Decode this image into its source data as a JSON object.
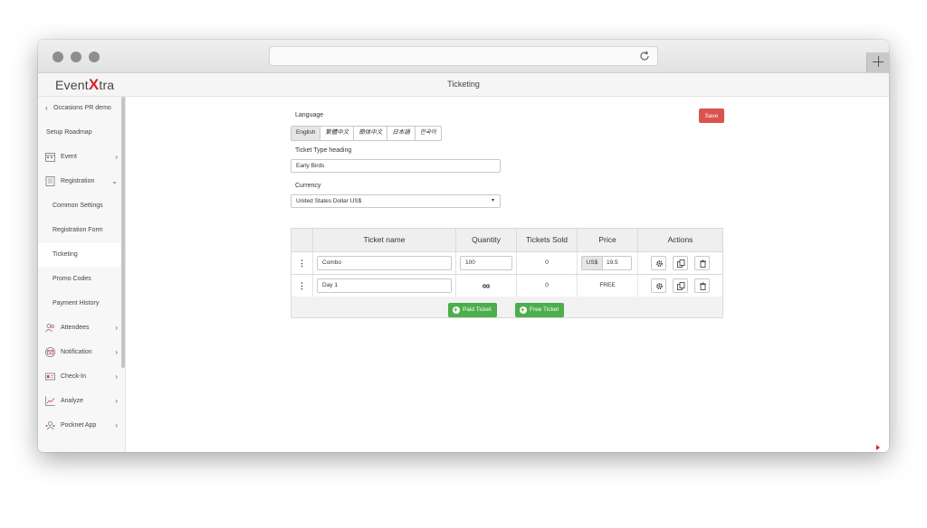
{
  "browser": {
    "url": ""
  },
  "app": {
    "logo_prefix": "Event",
    "logo_x": "X",
    "logo_suffix": "tra",
    "page_title": "Ticketing"
  },
  "sidebar": {
    "back_label": "Occasions PR demo",
    "items": [
      {
        "label": "Setup Roadmap",
        "icon": ""
      },
      {
        "label": "Event",
        "icon": "calendar-icon",
        "chevron": "›"
      },
      {
        "label": "Registration",
        "icon": "form-icon",
        "chevron": "⌄"
      },
      {
        "label": "Common Settings"
      },
      {
        "label": "Registration Form"
      },
      {
        "label": "Ticketing"
      },
      {
        "label": "Promo Codes"
      },
      {
        "label": "Payment History"
      },
      {
        "label": "Attendees",
        "icon": "people-icon",
        "chevron": "›"
      },
      {
        "label": "Notification",
        "icon": "envelope-icon",
        "chevron": "›"
      },
      {
        "label": "Check-In",
        "icon": "id-card-icon",
        "chevron": "›"
      },
      {
        "label": "Analyze",
        "icon": "chart-icon",
        "chevron": "›"
      },
      {
        "label": "Pocknet App",
        "icon": "app-people-icon",
        "chevron": "›"
      }
    ]
  },
  "form": {
    "save_label": "Save",
    "language_label": "Language",
    "languages": [
      "English",
      "繁體中文",
      "簡体中文",
      "日本語",
      "한국어"
    ],
    "heading_label": "Ticket Type heading",
    "heading_value": "Early Birds",
    "currency_label": "Currency",
    "currency_value": "United States Dollar US$"
  },
  "table": {
    "headers": [
      "Ticket name",
      "Quantity",
      "Tickets Sold",
      "Price",
      "Actions"
    ],
    "rows": [
      {
        "name": "Combo",
        "quantity": "100",
        "sold": "0",
        "price_prefix": "US$",
        "price": "19.5"
      },
      {
        "name": "Day 1",
        "quantity": "∞",
        "sold": "0",
        "price": "FREE"
      }
    ],
    "paid_button": "Paid Ticket",
    "free_button": "Free Ticket"
  },
  "colors": {
    "accent": "#d6232a",
    "save": "#d9534f",
    "add": "#4cae4c"
  }
}
